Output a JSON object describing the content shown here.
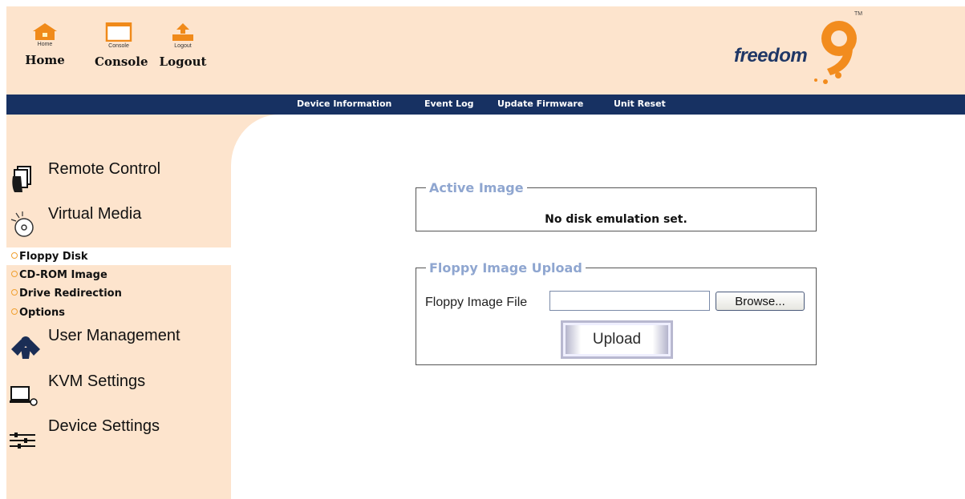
{
  "header": {
    "buttons": [
      {
        "name": "home",
        "small": "Home",
        "big": "Home"
      },
      {
        "name": "console",
        "small": "Console",
        "big": "Console"
      },
      {
        "name": "logout",
        "small": "Logout",
        "big": "Logout"
      }
    ],
    "logo_text": "freedom",
    "logo_digit": "9",
    "logo_tm": "TM"
  },
  "topnav": {
    "links": [
      "Device Information",
      "Event Log",
      "Update Firmware",
      "Unit Reset"
    ]
  },
  "sidebar": {
    "sections": [
      {
        "label": "Remote Control",
        "icon": "hand-window-icon"
      },
      {
        "label": "Virtual Media",
        "icon": "cd-disc-icon"
      },
      {
        "label": "User Management",
        "icon": "users-icon"
      },
      {
        "label": "KVM Settings",
        "icon": "monitor-icon"
      },
      {
        "label": "Device Settings",
        "icon": "sliders-icon"
      }
    ],
    "virtual_media_items": [
      "Floppy Disk",
      "CD-ROM Image",
      "Drive Redirection",
      "Options"
    ],
    "selected_item": "Floppy Disk"
  },
  "active_image": {
    "legend": "Active Image",
    "status": "No disk emulation set."
  },
  "floppy_upload": {
    "legend": "Floppy Image Upload",
    "file_label": "Floppy Image File",
    "file_value": "",
    "browse_label": "Browse...",
    "upload_label": "Upload"
  },
  "colors": {
    "header_bg": "#fde4cd",
    "nav_bg": "#173162",
    "legend": "#8fa6d0",
    "logo_orange": "#f28c1e",
    "logo_navy": "#1f3766"
  }
}
